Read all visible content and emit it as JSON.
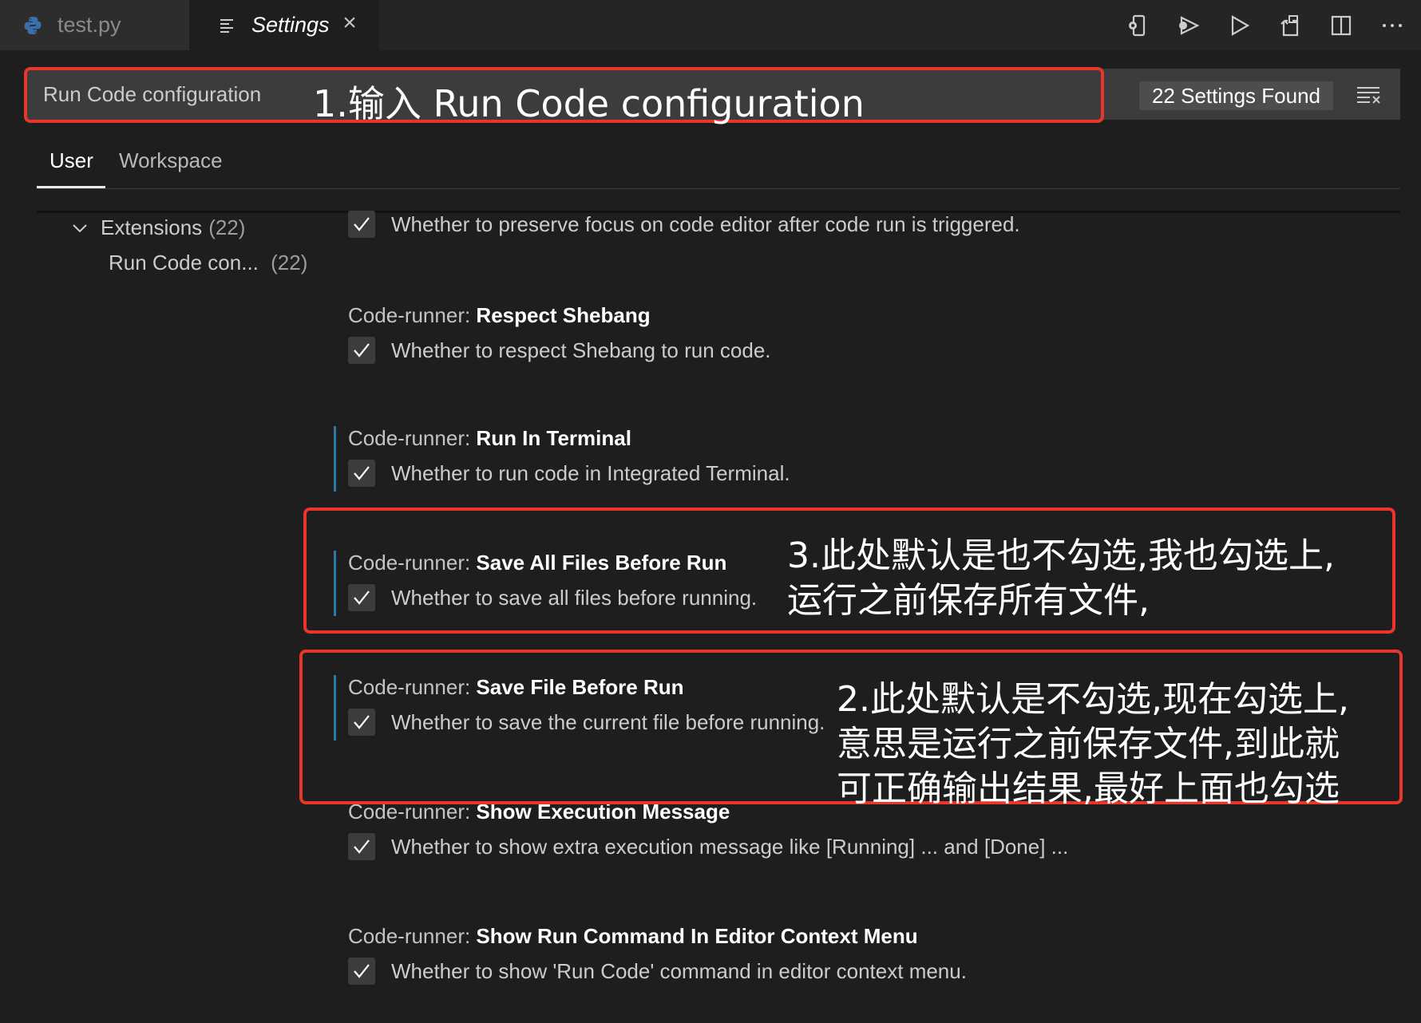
{
  "tabs": [
    {
      "label": "test.py",
      "icon": "python-icon",
      "active": false
    },
    {
      "label": "Settings",
      "icon": "settings-lines-icon",
      "active": true,
      "close": "×"
    }
  ],
  "editor_actions": [
    "remote-device-icon",
    "run-debug-icon",
    "run-icon",
    "open-settings-json-icon",
    "split-editor-icon",
    "more-actions-icon"
  ],
  "search": {
    "value": "Run Code configuration",
    "results_badge": "22 Settings Found",
    "clear_icon": "clear-filter-icon"
  },
  "scope_tabs": [
    "User",
    "Workspace"
  ],
  "toc": {
    "extensions_label": "Extensions",
    "extensions_count": "(22)",
    "runcode_label": "Run Code con...",
    "runcode_count": "(22)"
  },
  "settings": [
    {
      "category": "",
      "name": "",
      "description": "Whether to preserve focus on code editor after code run is triggered.",
      "checked": true,
      "modified": false
    },
    {
      "category": "Code-runner: ",
      "name": "Respect Shebang",
      "description": "Whether to respect Shebang to run code.",
      "checked": true,
      "modified": false
    },
    {
      "category": "Code-runner: ",
      "name": "Run In Terminal",
      "description": "Whether to run code in Integrated Terminal.",
      "checked": true,
      "modified": true
    },
    {
      "category": "Code-runner: ",
      "name": "Save All Files Before Run",
      "description": "Whether to save all files before running.",
      "checked": true,
      "modified": true
    },
    {
      "category": "Code-runner: ",
      "name": "Save File Before Run",
      "description": "Whether to save the current file before running.",
      "checked": true,
      "modified": true
    },
    {
      "category": "Code-runner: ",
      "name": "Show Execution Message",
      "description": "Whether to show extra execution message like [Running] ... and [Done] ...",
      "checked": true,
      "modified": false
    },
    {
      "category": "Code-runner: ",
      "name": "Show Run Command In Editor Context Menu",
      "description": "Whether to show 'Run Code' command in editor context menu.",
      "checked": true,
      "modified": false
    }
  ],
  "annotations": {
    "step1": "1.输入 Run Code configuration",
    "step3_line1": "3.此处默认是也不勾选,我也勾选上,",
    "step3_line2": "运行之前保存所有文件,",
    "step2_line1": "2.此处默认是不勾选,现在勾选上,",
    "step2_line2": "意思是运行之前保存文件,到此就",
    "step2_line3": "可正确输出结果,最好上面也勾选"
  },
  "colors": {
    "annotation_border": "#e8362a",
    "modified_indicator": "#2d7aa7",
    "background": "#1e1e1e"
  }
}
